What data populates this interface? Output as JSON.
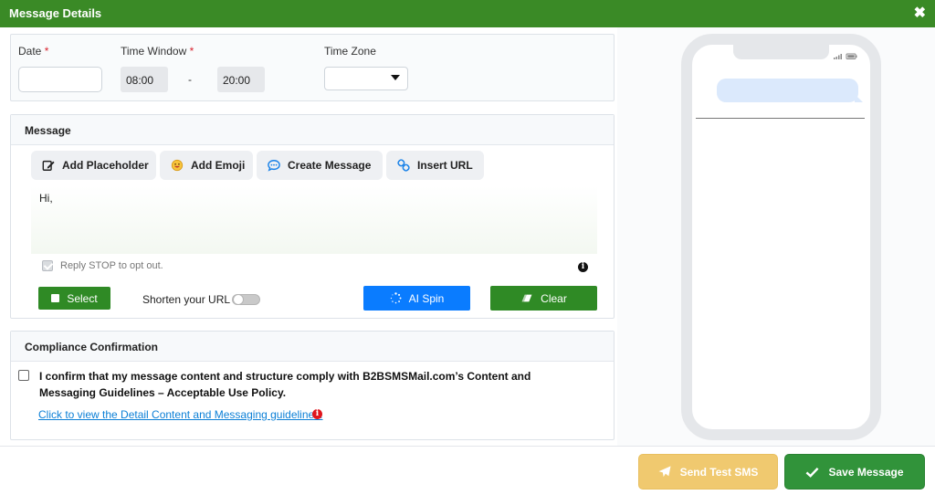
{
  "dialog": {
    "title": "Message Details",
    "close_glyph": "✖"
  },
  "schedule": {
    "date_label": "Date",
    "required_mark": "*",
    "time_window_label": "Time Window",
    "time_start": "08:00",
    "time_separator": "-",
    "time_end": "20:00",
    "time_zone_label": "Time Zone"
  },
  "message": {
    "section_title": "Message",
    "add_placeholder": "Add Placeholder",
    "add_emoji": "Add Emoji",
    "create_message": "Create Message",
    "insert_url": "Insert URL",
    "body": "Hi,",
    "reply_stop": "Reply STOP to opt out.",
    "info_glyph": "i",
    "select_label": "Select",
    "shorten_url_label": "Shorten your URL",
    "ai_spin_label": "AI Spin",
    "clear_label": "Clear"
  },
  "compliance": {
    "section_title": "Compliance Confirmation",
    "confirm_text": "I confirm that my message content and structure comply with B2BSMSMail.com’s Content and Messaging Guidelines – Acceptable Use Policy.",
    "guidelines_link": "Click to view the Detail Content and Messaging guidelines.",
    "info_glyph": "i"
  },
  "footer": {
    "send_test": "Send Test SMS",
    "save_message": "Save Message"
  },
  "colors": {
    "header_green": "#3a8a26",
    "action_green": "#2f8a25",
    "ai_blue": "#0a7cff",
    "test_yellow": "#f0c96f",
    "save_green": "#31933a",
    "link_blue": "#0b7fd6"
  },
  "icons": {
    "close": "close-icon",
    "placeholder": "edit-icon",
    "emoji": "emoji-icon",
    "create": "chat-bubble-icon",
    "url": "link-icon",
    "ai_spin": "spinner-icon",
    "clear": "eraser-icon",
    "send": "paper-plane-icon",
    "save": "checkmark-icon"
  }
}
